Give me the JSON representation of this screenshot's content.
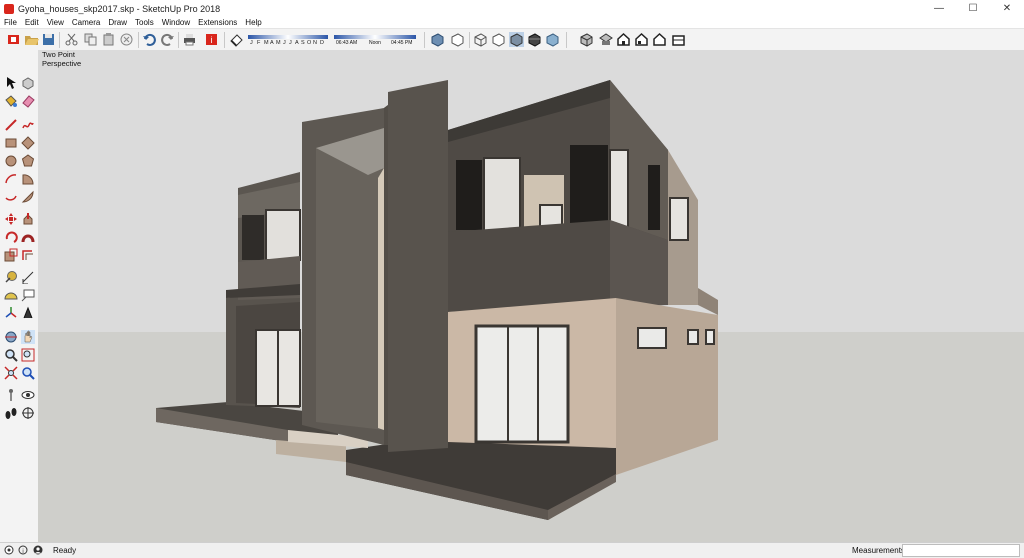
{
  "window": {
    "title": "Gyoha_houses_skp2017.skp - SketchUp Pro 2018",
    "controls": {
      "minimize": "—",
      "maximize": "☐",
      "close": "✕"
    }
  },
  "menu": [
    "File",
    "Edit",
    "View",
    "Camera",
    "Draw",
    "Tools",
    "Window",
    "Extensions",
    "Help"
  ],
  "shadow_settings": {
    "months": [
      "J",
      "F",
      "M",
      "A",
      "M",
      "J",
      "J",
      "A",
      "S",
      "O",
      "N",
      "D"
    ],
    "time_start": "06:43 AM",
    "time_noon": "Noon",
    "time_end": "04:45 PM"
  },
  "viewport": {
    "camera_mode_line1": "Two Point",
    "camera_mode_line2": "Perspective"
  },
  "status": {
    "text": "Ready",
    "measurements_label": "Measurements",
    "measurements_value": ""
  },
  "colors": {
    "accent_red": "#d9261c",
    "sky": "#dbdbdb",
    "ground": "#cfcfcb",
    "dark_wall": "#58534d",
    "light_wall": "#c8b7a6"
  },
  "icons": {
    "toolbar": [
      "select-icon",
      "open-icon",
      "save-icon",
      "cut-icon",
      "copy-icon",
      "paste-icon",
      "erase-icon",
      "undo-icon",
      "redo-icon",
      "print-icon",
      "model-info-icon",
      "shadow-toggle-icon",
      "xray-icon",
      "wireframe-icon",
      "hidden-line-icon",
      "shaded-icon",
      "shaded-texture-icon",
      "monochrome-icon",
      "iso-view-icon",
      "top-view-icon",
      "front-view-icon",
      "right-view-icon",
      "back-view-icon",
      "left-view-icon"
    ],
    "left": [
      "select-icon",
      "component-icon",
      "paint-bucket-icon",
      "eraser-icon",
      "line-icon",
      "freehand-icon",
      "rectangle-icon",
      "rotated-rect-icon",
      "circle-icon",
      "polygon-icon",
      "arc-icon",
      "pie-icon",
      "move-icon",
      "push-pull-icon",
      "rotate-icon",
      "follow-me-icon",
      "scale-icon",
      "offset-icon",
      "tape-measure-icon",
      "dimension-icon",
      "protractor-icon",
      "text-icon",
      "axes-icon",
      "3d-text-icon",
      "orbit-icon",
      "pan-icon",
      "zoom-icon",
      "zoom-window-icon",
      "zoom-extents-icon",
      "previous-view-icon",
      "position-camera-icon",
      "look-around-icon",
      "walk-icon",
      "section-plane-icon"
    ]
  }
}
